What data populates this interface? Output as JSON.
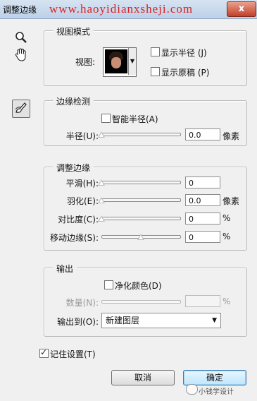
{
  "window": {
    "title": "调整边缘",
    "watermark": "www.haoyidianxsheji.com",
    "close": "x"
  },
  "tools": [
    "zoom-icon",
    "hand-icon",
    "refine-radius-brush-icon"
  ],
  "view_mode": {
    "legend": "视图模式",
    "view_label": "视图:",
    "show_radius": {
      "label": "显示半径 (J)",
      "checked": false
    },
    "show_original": {
      "label": "显示原稿 (P)",
      "checked": false
    }
  },
  "edge_detection": {
    "legend": "边缘检测",
    "smart_radius": {
      "label": "智能半径(A)",
      "checked": false
    },
    "radius": {
      "label": "半径(U):",
      "value": "0.0",
      "unit": "像素",
      "level": 0
    }
  },
  "adjust_edge": {
    "legend": "调整边缘",
    "smooth": {
      "label": "平滑(H):",
      "value": "0",
      "unit": "",
      "level": 0
    },
    "feather": {
      "label": "羽化(E):",
      "value": "0.0",
      "unit": "像素",
      "level": 0
    },
    "contrast": {
      "label": "对比度(C):",
      "value": "0",
      "unit": "%",
      "level": 0
    },
    "shift_edge": {
      "label": "移动边缘(S):",
      "value": "0",
      "unit": "%",
      "level": 0.5
    }
  },
  "output": {
    "legend": "输出",
    "decontaminate": {
      "label": "净化颜色(D)",
      "checked": false
    },
    "amount": {
      "label": "数量(N):",
      "value": "",
      "unit": "%"
    },
    "output_to": {
      "label": "输出到(O):",
      "selected": "新建图层"
    }
  },
  "remember": {
    "label": "记住设置(T)",
    "checked": true
  },
  "buttons": {
    "cancel": "取消",
    "ok": "确定"
  },
  "credit": "小钱学设计"
}
